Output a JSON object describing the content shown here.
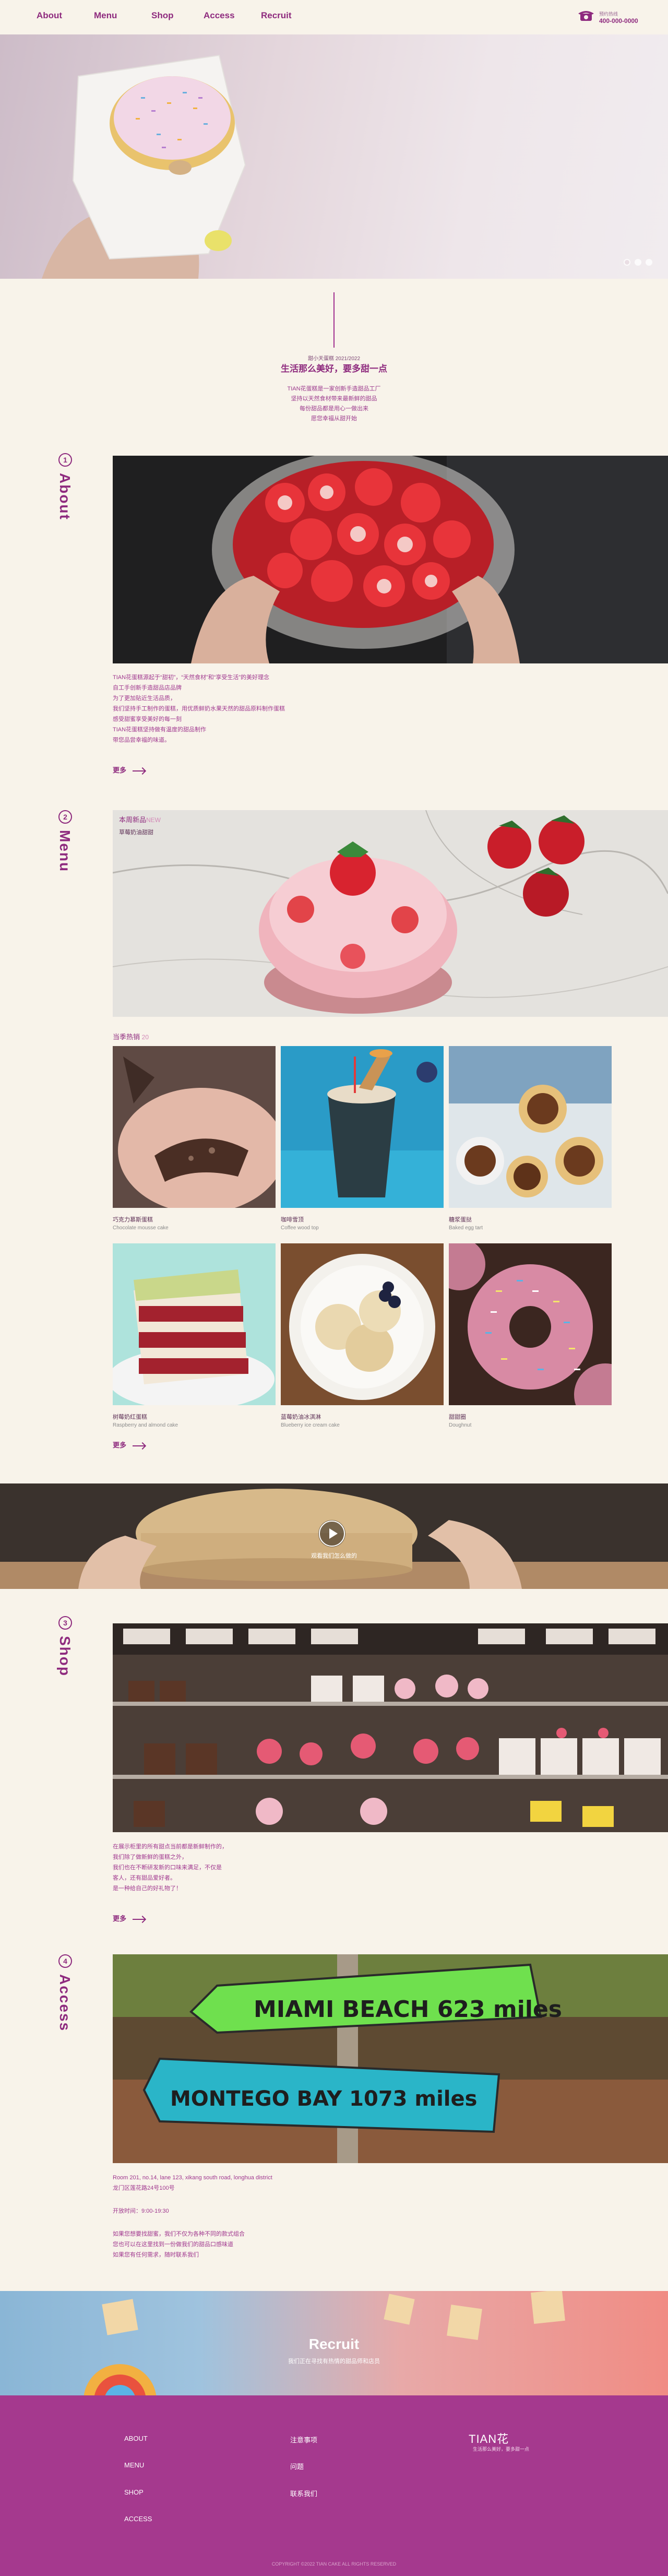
{
  "nav": {
    "links": [
      "About",
      "Menu",
      "Shop",
      "Access",
      "Recruit"
    ],
    "tel_label": "预约热线",
    "tel_number": "400-000-0000"
  },
  "hero": {
    "slides": 3,
    "active_slide": 1
  },
  "intro": {
    "sub": "甜小天蛋糕 2021/2022",
    "title": "生活那么美好，要多甜一点",
    "lines": [
      "TIAN花蛋糕是一家创新手造甜品工厂",
      "坚持以天然食材带来最新鲜的甜品",
      "每份甜品都是用心一做出来",
      "愿您幸福从甜开始"
    ]
  },
  "about": {
    "number": "1",
    "title": "About",
    "lines": [
      "TIAN花蛋糕源起于“甜初”，“天然食材”和“享受生活”的美好理念",
      "自工手创新手造甜品店品牌",
      "为了更加贴近生活品质，",
      "我们坚持手工制作的蛋糕，用优质鲜奶水果天然的甜品原料制作蛋糕",
      "感受甜蜜享受美好的每一刻",
      "TIAN花蛋糕坚持做有温度的甜品制作",
      "带您品尝幸福的味道。"
    ],
    "more": "更多"
  },
  "menu": {
    "number": "2",
    "title": "Menu",
    "feature_label": "本周新品",
    "feature_label_en": "NEW",
    "feature_name": "草莓奶油甜甜",
    "seasonal_label": "当季热销",
    "seasonal_label_en": "20",
    "products": [
      {
        "cn": "巧克力慕斯蛋糕",
        "en": "Chocolate mousse cake"
      },
      {
        "cn": "咖啡雪顶",
        "en": "Coffee wood top"
      },
      {
        "cn": "糖浆蛋挞",
        "en": "Baked egg tart"
      },
      {
        "cn": "树莓奶红蛋糕",
        "en": "Raspberry and almond cake"
      },
      {
        "cn": "蓝莓奶油冰淇淋",
        "en": "Blueberry ice cream cake"
      },
      {
        "cn": "甜甜圈",
        "en": "Doughnut"
      }
    ],
    "more": "更多"
  },
  "video": {
    "label": "观看我们怎么做的"
  },
  "shop": {
    "number": "3",
    "title": "Shop",
    "lines": [
      "在展示柜里的所有甜点当前都是新鲜制作的，",
      "我们除了做新鲜的蛋糕之外，",
      "我们也在不断研发新的口味来满足，不仅是",
      "客人，还有甜品爱好者。",
      "是一种给自己的好礼物了！"
    ],
    "more": "更多"
  },
  "access": {
    "number": "4",
    "title": "Access",
    "address_lines": [
      "Room 201, no.14, lane 123, xikang south road, longhua district",
      "龙门区莲花路24号100号"
    ],
    "hours": "开放时间：9:00-19:30",
    "note_lines": [
      "如果您想要找甜蜜，我们不仅为各种不同的款式组合",
      "您也可以在这里找到一份做我们的甜品口感味道",
      "如果您有任何需求，随时联系我们"
    ]
  },
  "recruit": {
    "title": "Recruit",
    "sub": "我们正在寻找有热情的甜品师和店员"
  },
  "footer": {
    "col1": [
      "ABOUT",
      "MENU",
      "SHOP",
      "ACCESS"
    ],
    "col2": [
      "注意事项",
      "问题",
      "联系我们"
    ],
    "logo": "TIAN花",
    "logo_sub": "生活那么美好，要多甜一点",
    "copyright": "COPYRIGHT ©2022 TIAN CAKE ALL RIGHTS RESERVED"
  },
  "colors": {
    "brand": "#8e2a7e",
    "background": "#f8f3ea",
    "footer": "#a5398e"
  }
}
